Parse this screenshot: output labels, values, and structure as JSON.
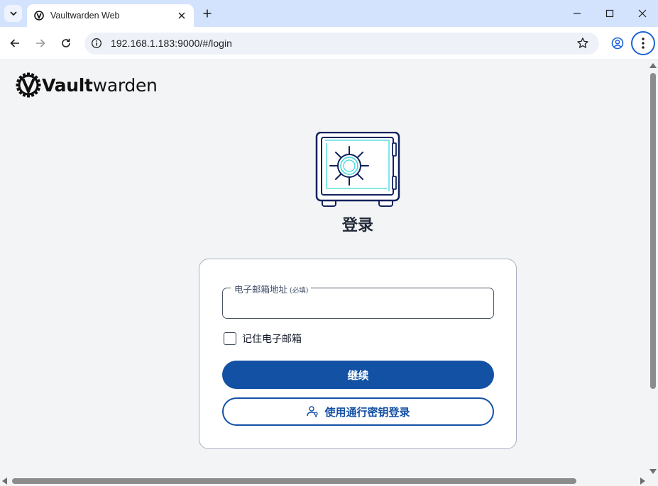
{
  "browser": {
    "tab_title": "Vaultwarden Web",
    "url": "192.168.1.183:9000/#/login",
    "tab_favicon": "vaultwarden-favicon",
    "colors": {
      "tabstrip": "#d3e3fd",
      "omnibox": "#eef2f8",
      "menu_ring": "#1d63d5"
    }
  },
  "page": {
    "logo": {
      "bold": "Vault",
      "rest": "warden"
    },
    "title": "登录",
    "email_field": {
      "label": "电子邮箱地址",
      "required_hint": "(必填)",
      "value": ""
    },
    "remember_email": {
      "label": "记住电子邮箱",
      "checked": false
    },
    "continue_button": "继续",
    "passkey_button": "使用通行密钥登录",
    "colors": {
      "primary": "#1351a5",
      "background": "#f3f4f6",
      "safe_outline": "#11225e",
      "safe_accent": "#3fd8d8"
    }
  }
}
